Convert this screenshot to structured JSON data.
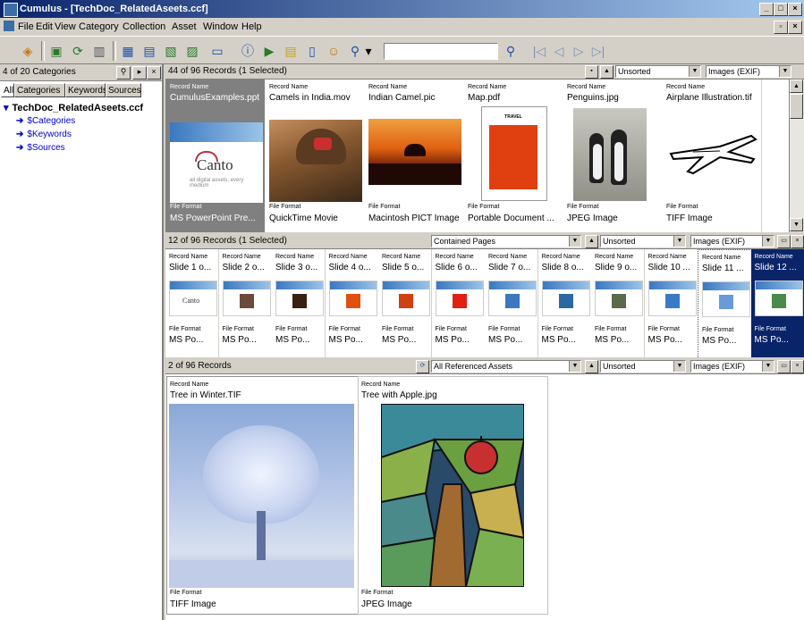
{
  "window": {
    "title": "Cumulus - [TechDoc_RelatedAseets.ccf]",
    "min_glyph": "_",
    "max_glyph": "□",
    "close_glyph": "×",
    "restore_glyph": "▫"
  },
  "menu": [
    "File",
    "Edit",
    "View",
    "Category",
    "Collection",
    "Asset",
    "Window",
    "Help"
  ],
  "toolbar": {
    "search_value": "",
    "search_icon": "magnifier-icon",
    "nav_glyphs": [
      "|◁",
      "◁",
      "▷",
      "▷|"
    ],
    "dropdown_glyph": "▾"
  },
  "left_pane": {
    "header": "4 of 20 Categories",
    "tabs": [
      "All",
      "Categories",
      "Keywords",
      "Sources"
    ],
    "tree": {
      "root": "TechDoc_RelatedAseets.ccf",
      "children": [
        "$Categories",
        "$Keywords",
        "$Sources"
      ]
    },
    "arrow_glyph": "➔",
    "expand_glyph": "▾",
    "header_buttons": [
      "⚲",
      "▸",
      "×"
    ]
  },
  "panel1": {
    "count": "44 of 96 Records (1 Selected)",
    "sort": "Unsorted",
    "view": "Images (EXIF)",
    "field1": "Record Name",
    "field2": "File Format",
    "records": [
      {
        "name": "CumulusExamples.ppt",
        "format": "MS PowerPoint Pre..."
      },
      {
        "name": "Camels in India.mov",
        "format": "QuickTime Movie"
      },
      {
        "name": "Indian Camel.pic",
        "format": "Macintosh PICT Image"
      },
      {
        "name": "Map.pdf",
        "format": "Portable Document ..."
      },
      {
        "name": "Penguins.jpg",
        "format": "JPEG Image"
      },
      {
        "name": "Airplane Illustration.tif",
        "format": "TIFF Image"
      }
    ],
    "canto_logo": "Canto",
    "canto_tagline": "all digital assets, every medium",
    "map_label": "TRAVEL"
  },
  "panel2": {
    "count": "12 of 96 Records (1 Selected)",
    "mode": "Contained Pages",
    "sort": "Unsorted",
    "view": "Images (EXIF)",
    "field1": "Record Name",
    "field2": "File Format",
    "records": [
      {
        "name": "Slide 1 o...",
        "format": "MS Po..."
      },
      {
        "name": "Slide 2 o...",
        "format": "MS Po..."
      },
      {
        "name": "Slide 3 o...",
        "format": "MS Po..."
      },
      {
        "name": "Slide 4 o...",
        "format": "MS Po..."
      },
      {
        "name": "Slide 5 o...",
        "format": "MS Po..."
      },
      {
        "name": "Slide 6 o...",
        "format": "MS Po..."
      },
      {
        "name": "Slide 7 o...",
        "format": "MS Po..."
      },
      {
        "name": "Slide 8 o...",
        "format": "MS Po..."
      },
      {
        "name": "Slide 9 o...",
        "format": "MS Po..."
      },
      {
        "name": "Slide 10 ...",
        "format": "MS Po..."
      },
      {
        "name": "Slide 11 ...",
        "format": "MS Po..."
      },
      {
        "name": "Slide 12 ...",
        "format": "MS Po..."
      }
    ],
    "canto_small": "Canto"
  },
  "panel3": {
    "count": "2 of 96 Records",
    "mode": "All Referenced Assets",
    "sort": "Unsorted",
    "view": "Images (EXIF)",
    "field1": "Record Name",
    "field2": "File Format",
    "records": [
      {
        "name": "Tree in Winter.TIF",
        "format": "TIFF Image"
      },
      {
        "name": "Tree with Apple.jpg",
        "format": "JPEG Image"
      }
    ]
  },
  "colors": {
    "title_bar": "#0a246a",
    "selection": "#0a246a",
    "link": "#0000cc"
  }
}
